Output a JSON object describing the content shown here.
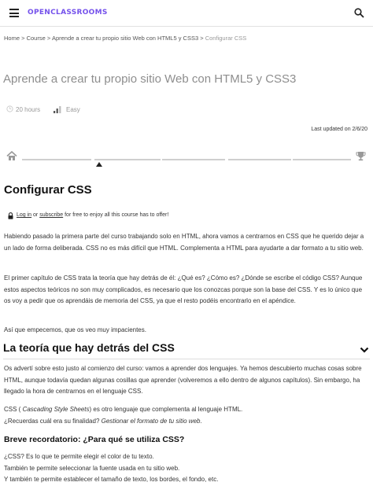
{
  "header": {
    "logo_text": "OPENCLASSROOMS",
    "menu_icon": "hamburger-icon",
    "search_icon": "search-icon"
  },
  "breadcrumb": {
    "home": "Home",
    "course": "Course",
    "course_name": "Aprende a crear tu propio sitio Web con HTML5 y CSS3",
    "current": "Configurar CSS",
    "separator": ">"
  },
  "course": {
    "title": "Aprende a crear tu propio sitio Web con HTML5 y CSS3",
    "duration": "20 hours",
    "difficulty": "Easy",
    "last_updated": "Last updated on 2/6/20"
  },
  "chapter": {
    "title": "Configurar CSS",
    "login_link": "Log in",
    "login_or": " or ",
    "subscribe_link": "subscribe",
    "login_suffix": " for free to enjoy all this course has to offer!",
    "p1": "Habiendo pasado la primera parte del curso trabajando solo en HTML, ahora vamos a centrarnos en CSS que he querido dejar a un lado de forma deliberada. CSS no es más difícil que HTML. Complementa a HTML para ayudarte a dar formato a tu sitio web.",
    "p2": "El primer capítulo de CSS trata la teoría que hay detrás de él: ¿Qué es? ¿Cómo es? ¿Dónde se escribe el código CSS? Aunque estos aspectos teóricos no son muy complicados, es necesario que los conozcas porque son la base del CSS. Y es lo único que os voy a pedir que os aprendáis de memoria del CSS, ya que el resto podéis encontrarlo en el apéndice.",
    "p3": "Así que empecemos, que os veo muy impacientes.",
    "section_title": "La teoría que hay detrás del CSS",
    "p4": "Os advertí sobre esto justo al comienzo del curso: vamos a aprender dos lenguajes. Ya hemos descubierto muchas cosas sobre HTML, aunque todavía quedan algunas cosillas que aprender (volveremos a ello dentro de algunos capítulos). Sin embargo, ha llegado la hora de centrarnos en el lenguaje CSS.",
    "p5_start": "CSS ( ",
    "p5_em": "Cascading Style Sheets",
    "p5_end": ") es otro lenguaje que complementa al lenguaje HTML.",
    "p5_question": "¿Recuerdas cuál era su finalidad? ",
    "p5_em2": "Gestionar el formato de tu sitio web",
    "p5_dot": ".",
    "subsection_title": "Breve recordatorio: ¿Para qué se utiliza CSS?",
    "p6_l1": "¿CSS? Es lo que te permite elegir el color de tu texto.",
    "p6_l2": "También te permite seleccionar la fuente usada en tu sitio web.",
    "p6_l3": "Y también te permite establecer el tamaño de texto, los bordes, el fondo, etc."
  },
  "colors": {
    "brand": "#7451eb",
    "muted": "#999999",
    "text": "#333333"
  }
}
